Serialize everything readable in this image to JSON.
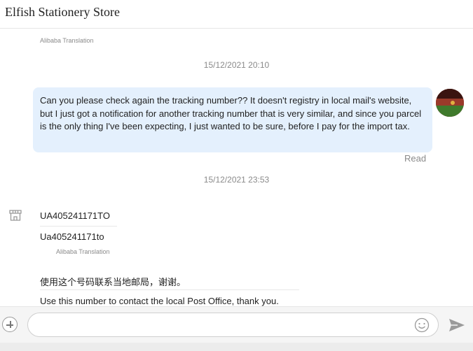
{
  "header": {
    "store_name": "Elfish Stationery Store"
  },
  "messages": {
    "top_translation_label": "Alibaba Translation",
    "timestamp_1": "15/12/2021 20:10",
    "outgoing_text": "Can you please check again the tracking number?? It doesn't registry in local mail's website, but I just got a notification for another tracking number that is very similar, and since you parcel is the only thing I've been expecting, I just wanted to be sure, before I pay for the import tax.",
    "read_status": "Read",
    "timestamp_2": "15/12/2021 23:53",
    "incoming_original": "UA405241171TO",
    "incoming_translated": "Ua405241171to",
    "incoming_translation_label": "Alibaba Translation",
    "incoming2_original": "使用这个号码联系当地邮局，谢谢。",
    "incoming2_translated": "Use this number to contact the local Post Office, thank you."
  },
  "composer": {
    "placeholder": ""
  },
  "icons": {
    "shop": "shop-icon",
    "avatar": "user-avatar",
    "plus": "plus-icon",
    "emoji": "emoji-icon",
    "send": "send-icon"
  },
  "colors": {
    "bubble_bg": "#e4f0fd",
    "meta_grey": "#8a8a8a"
  }
}
